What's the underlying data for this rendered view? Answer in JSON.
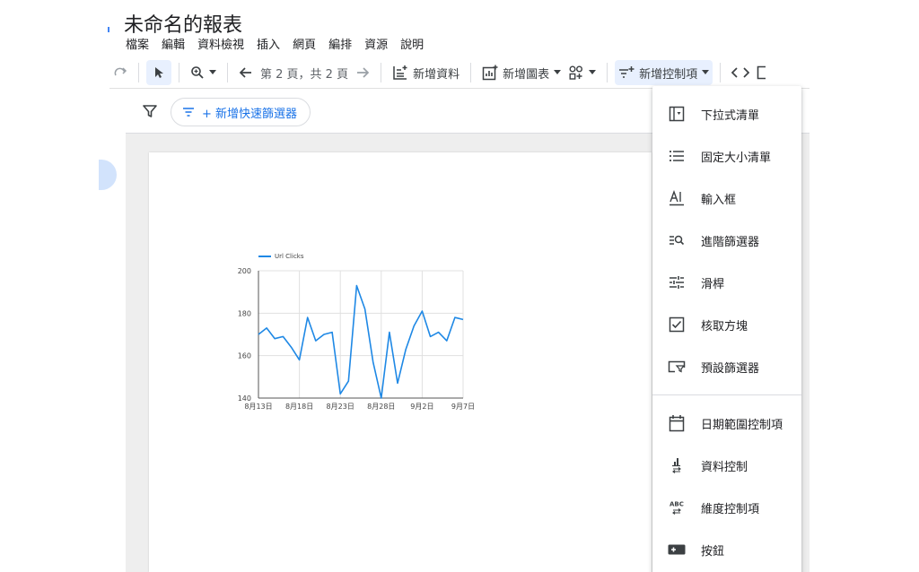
{
  "app": {
    "title": "未命名的報表",
    "menu": [
      "檔案",
      "編輯",
      "資料檢視",
      "插入",
      "網頁",
      "編排",
      "資源",
      "說明"
    ]
  },
  "toolbar": {
    "page_indicator": "第 2 頁，共 2 頁",
    "add_data_label": "新增資料",
    "add_chart_label": "新增圖表",
    "add_control_label": "新增控制項"
  },
  "filter_bar": {
    "quick_filter_label": "+ 新增快速篩選器"
  },
  "control_menu": {
    "items": [
      {
        "label": "下拉式清單",
        "icon": "dropdown-list-icon"
      },
      {
        "label": "固定大小清單",
        "icon": "fixed-list-icon"
      },
      {
        "label": "輸入框",
        "icon": "input-box-icon"
      },
      {
        "label": "進階篩選器",
        "icon": "advanced-filter-icon"
      },
      {
        "label": "滑桿",
        "icon": "slider-icon"
      },
      {
        "label": "核取方塊",
        "icon": "checkbox-icon"
      },
      {
        "label": "預設篩選器",
        "icon": "preset-filter-icon"
      },
      {
        "label": "日期範圍控制項",
        "icon": "calendar-icon"
      },
      {
        "label": "資料控制",
        "icon": "data-control-icon"
      },
      {
        "label": "維度控制項",
        "icon": "dimension-control-icon"
      },
      {
        "label": "按鈕",
        "icon": "button-icon"
      }
    ]
  },
  "chart_data": {
    "type": "line",
    "series": [
      {
        "name": "Url Clicks",
        "color": "#1e88e5",
        "values": [
          170,
          173,
          168,
          169,
          164,
          158,
          178,
          167,
          170,
          171,
          142,
          148,
          193,
          182,
          157,
          140,
          171,
          147,
          163,
          174,
          181,
          169,
          171,
          167,
          178,
          177
        ]
      }
    ],
    "x_tick_labels": [
      "8月13日",
      "8月18日",
      "8月23日",
      "8月28日",
      "9月2日",
      "9月7日"
    ],
    "y_tick_labels": [
      "140",
      "160",
      "180",
      "200"
    ],
    "ylim": [
      140,
      200
    ],
    "grid": true,
    "legend": "top-left"
  }
}
